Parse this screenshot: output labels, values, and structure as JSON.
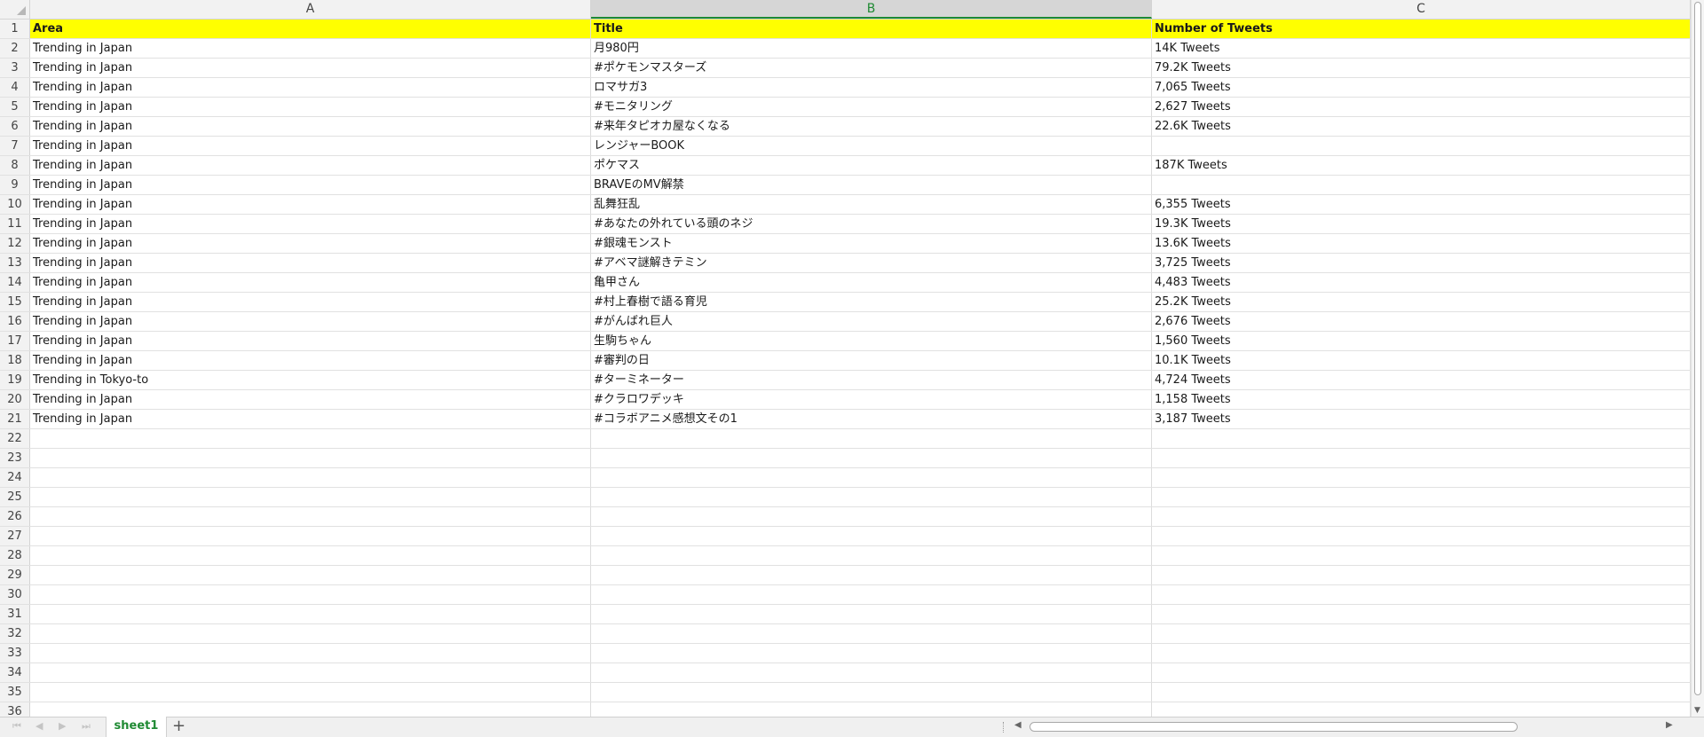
{
  "columns": [
    {
      "letter": "A",
      "selected": false
    },
    {
      "letter": "B",
      "selected": true
    },
    {
      "letter": "C",
      "selected": false
    }
  ],
  "header_row": {
    "a": "Area",
    "b": "Title",
    "c": "Number of Tweets"
  },
  "rows": [
    {
      "a": "Trending in Japan",
      "b": "月980円",
      "c": "14K Tweets"
    },
    {
      "a": "Trending in Japan",
      "b": "#ポケモンマスターズ",
      "c": "79.2K Tweets"
    },
    {
      "a": "Trending in Japan",
      "b": "ロマサガ3",
      "c": "7,065 Tweets"
    },
    {
      "a": "Trending in Japan",
      "b": "#モニタリング",
      "c": "2,627 Tweets"
    },
    {
      "a": "Trending in Japan",
      "b": "#来年タピオカ屋なくなる",
      "c": "22.6K Tweets"
    },
    {
      "a": "Trending in Japan",
      "b": "レンジャーBOOK",
      "c": ""
    },
    {
      "a": "Trending in Japan",
      "b": "ポケマス",
      "c": "187K Tweets"
    },
    {
      "a": "Trending in Japan",
      "b": "BRAVEのMV解禁",
      "c": ""
    },
    {
      "a": "Trending in Japan",
      "b": "乱舞狂乱",
      "c": "6,355 Tweets"
    },
    {
      "a": "Trending in Japan",
      "b": "#あなたの外れている頭のネジ",
      "c": "19.3K Tweets"
    },
    {
      "a": "Trending in Japan",
      "b": "#銀魂モンスト",
      "c": "13.6K Tweets"
    },
    {
      "a": "Trending in Japan",
      "b": "#アベマ謎解きテミン",
      "c": "3,725 Tweets"
    },
    {
      "a": "Trending in Japan",
      "b": "亀甲さん",
      "c": "4,483 Tweets"
    },
    {
      "a": "Trending in Japan",
      "b": "#村上春樹で語る育児",
      "c": "25.2K Tweets"
    },
    {
      "a": "Trending in Japan",
      "b": "#がんばれ巨人",
      "c": "2,676 Tweets"
    },
    {
      "a": "Trending in Japan",
      "b": "生駒ちゃん",
      "c": "1,560 Tweets"
    },
    {
      "a": "Trending in Japan",
      "b": "#審判の日",
      "c": "10.1K Tweets"
    },
    {
      "a": "Trending in Tokyo-to",
      "b": "#ターミネーター",
      "c": "4,724 Tweets"
    },
    {
      "a": "Trending in Japan",
      "b": "#クラロワデッキ",
      "c": "1,158 Tweets"
    },
    {
      "a": "Trending in Japan",
      "b": "#コラボアニメ感想文その1",
      "c": "3,187 Tweets"
    }
  ],
  "row_numbers": [
    "1",
    "2",
    "3",
    "4",
    "5",
    "6",
    "7",
    "8",
    "9",
    "10",
    "11",
    "12",
    "13",
    "14",
    "15",
    "16",
    "17",
    "18",
    "19",
    "20",
    "21",
    "22",
    "23",
    "24",
    "25",
    "26",
    "27",
    "28",
    "29",
    "30",
    "31",
    "32",
    "33",
    "34",
    "35",
    "36"
  ],
  "sheet_tab": "sheet1",
  "add_sheet_label": "+",
  "colors": {
    "header_fill": "#ffff00",
    "accent": "#1f8a33"
  }
}
